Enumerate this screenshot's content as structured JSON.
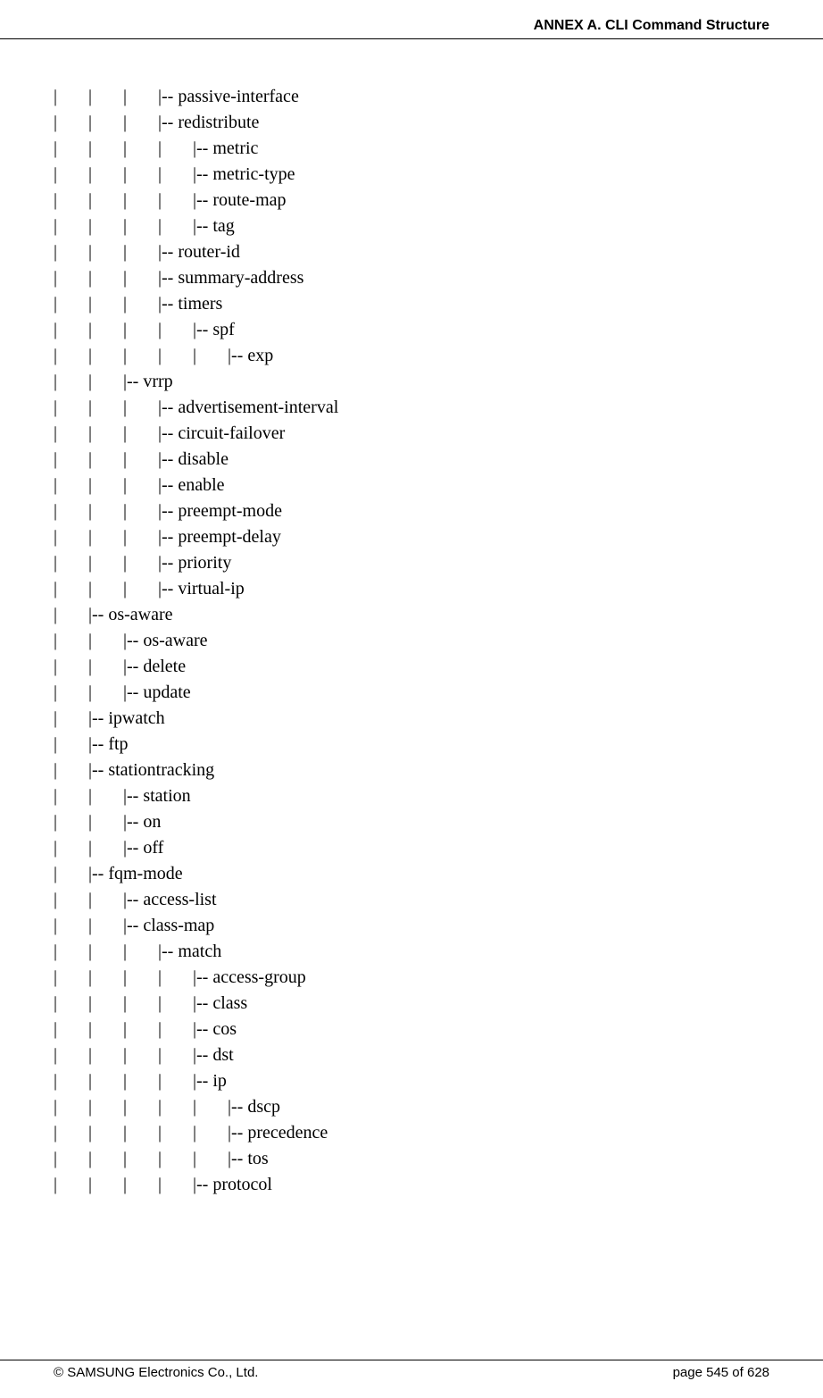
{
  "header": "ANNEX A. CLI Command Structure",
  "lines": [
    "|       |       |       |-- passive-interface",
    "|       |       |       |-- redistribute",
    "|       |       |       |       |-- metric",
    "|       |       |       |       |-- metric-type",
    "|       |       |       |       |-- route-map",
    "|       |       |       |       |-- tag",
    "|       |       |       |-- router-id",
    "|       |       |       |-- summary-address",
    "|       |       |       |-- timers",
    "|       |       |       |       |-- spf",
    "|       |       |       |       |       |-- exp",
    "|       |       |-- vrrp",
    "|       |       |       |-- advertisement-interval",
    "|       |       |       |-- circuit-failover",
    "|       |       |       |-- disable",
    "|       |       |       |-- enable",
    "|       |       |       |-- preempt-mode",
    "|       |       |       |-- preempt-delay",
    "|       |       |       |-- priority",
    "|       |       |       |-- virtual-ip",
    "|       |-- os-aware",
    "|       |       |-- os-aware",
    "|       |       |-- delete",
    "|       |       |-- update",
    "|       |-- ipwatch",
    "|       |-- ftp",
    "|       |-- stationtracking",
    "|       |       |-- station",
    "|       |       |-- on",
    "|       |       |-- off",
    "|       |-- fqm-mode",
    "|       |       |-- access-list",
    "|       |       |-- class-map",
    "|       |       |       |-- match",
    "|       |       |       |       |-- access-group",
    "|       |       |       |       |-- class",
    "|       |       |       |       |-- cos",
    "|       |       |       |       |-- dst",
    "|       |       |       |       |-- ip",
    "|       |       |       |       |       |-- dscp",
    "|       |       |       |       |       |-- precedence",
    "|       |       |       |       |       |-- tos",
    "|       |       |       |       |-- protocol"
  ],
  "footer": {
    "left": "© SAMSUNG Electronics Co., Ltd.",
    "right": "page 545 of 628"
  }
}
